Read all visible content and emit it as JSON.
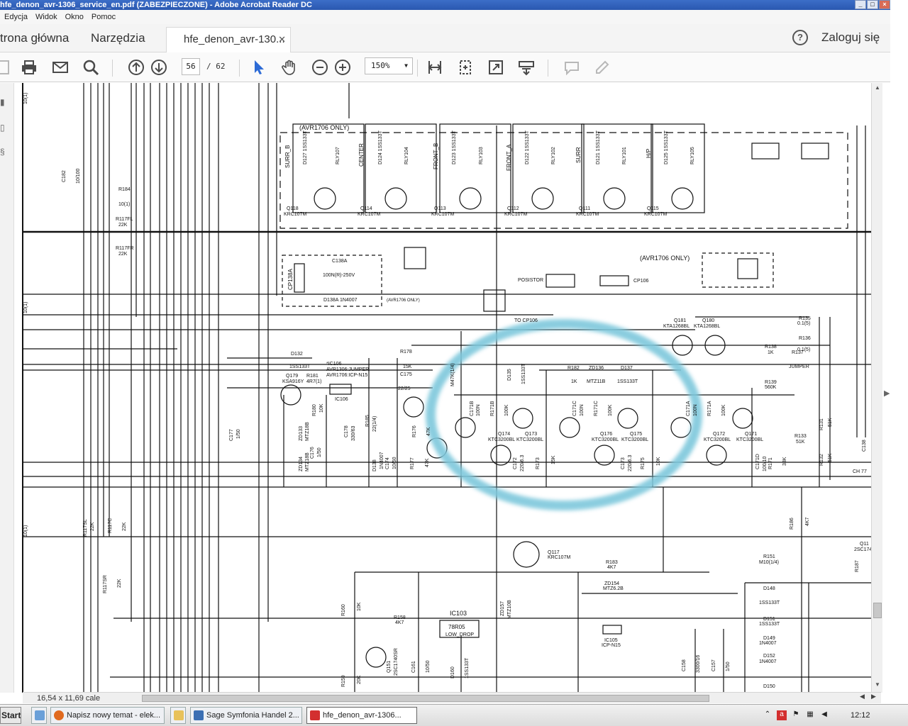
{
  "window": {
    "title": "hfe_denon_avr-1306_service_en.pdf (ZABEZPIECZONE) - Adobe Acrobat Reader DC"
  },
  "menu": [
    "Edycja",
    "Widok",
    "Okno",
    "Pomoc"
  ],
  "tabs": {
    "home": "trona główna",
    "tools": "Narzędzia",
    "doc": "hfe_denon_avr-130...",
    "help": "?",
    "login": "Zaloguj się"
  },
  "toolbar": {
    "page_current": "56",
    "page_total": "/ 62",
    "zoom": "150%"
  },
  "status": {
    "page_size": "16,54 x 11,69 cale"
  },
  "taskbar": {
    "start": "Start",
    "items": [
      {
        "label": "Napisz nowy temat - elek...",
        "icon_color": "#e06a1f"
      },
      {
        "label": "Sage Symfonia Handel 2...",
        "icon_color": "#3b6fb3"
      },
      {
        "label": "hfe_denon_avr-1306...",
        "icon_color": "#d32f2f"
      }
    ],
    "clock": "12:12"
  },
  "schematic": {
    "top_labels": {
      "avr1706_only_a": "(AVR1706 ONLY)",
      "avr1706_only_b": "(AVR1706 ONLY)",
      "avr1706_only_c": "(AVR1706 ONLY)",
      "surr_b": "SURR_B",
      "center": "CENTER",
      "front_b": "FRONT_B",
      "front_a": "FRONT_A",
      "surr": "SURR",
      "hp": "H/P"
    },
    "diodes": [
      "D127 1SS133T",
      "D124 1SS133T",
      "D123 1SS133T",
      "D122 1SS133T",
      "D121 1SS133T",
      "D125 1SS133T"
    ],
    "relays": [
      "RLY107",
      "RLY104",
      "RLY103",
      "RLY102",
      "RLY101",
      "RLY105"
    ],
    "transistors_top": [
      {
        "name": "Q118",
        "part": "KRC107M"
      },
      {
        "name": "Q114",
        "part": "KRC107M"
      },
      {
        "name": "Q113",
        "part": "KRC107M"
      },
      {
        "name": "Q112",
        "part": "KRC107M"
      },
      {
        "name": "Q111",
        "part": "KRC107M"
      },
      {
        "name": "Q115",
        "part": "KRC107M"
      }
    ],
    "misc_labels": {
      "r184": "R184",
      "r184v": "10(1)",
      "r117fl": "R117FL",
      "r117flv": "22K",
      "r117fr": "R117FR",
      "r117frv": "22K",
      "c182": "C182",
      "c182v": "10/100",
      "r10_1a": "10(1)",
      "r10_1b": "10(1)",
      "r10_1c": "10(1)",
      "cp138a": "CP138A",
      "c138a": "C138A",
      "c138av": "100N(R)-250V",
      "d138a": "D138A 1N4007",
      "avr_only": "(AVR1706 ONLY)",
      "posistor": "POSISTOR",
      "cp106": "CP106",
      "to_cp106": "TO CP106",
      "d132": "D132",
      "d132v": "1SS133T",
      "q179": "Q179",
      "q179v": "KSA916Y",
      "r181": "R181",
      "r181v": "4R7(1)",
      "ic106a": "*IC106",
      "ic106b": "AVR1306:JUMPER",
      "ic106c": "AVR1706:ICP-N15",
      "ic106": "IC106",
      "r178": "R178",
      "r178v": "15K",
      "c175": "C175",
      "c175v": "22/25",
      "m47k": "M47K(1/4)",
      "d135": "D135",
      "d135v": "1SS133T",
      "r182": "R182",
      "r182v": "1K",
      "zd136": "ZD136",
      "zd136v": "MTZ11B",
      "d137": "D137",
      "d137v": "1SS133T",
      "q181": "Q181",
      "q181v": "KTA1268BL",
      "q180": "Q180",
      "q180v": "KTA1268BL",
      "r138": "R138",
      "r138v": "1K",
      "r137": "R137",
      "r137v": "JUMPER",
      "r139": "R139",
      "r139v": "560K",
      "r135": "R135",
      "r135v": "0.1(5)",
      "r136": "R136",
      "r136v": "0.1(5)",
      "q174": "Q174",
      "q174v": "KTC3200BL",
      "q173": "Q173",
      "q173v": "KTC3200BL",
      "q176": "Q176",
      "q176v": "KTC3200BL",
      "q175": "Q175",
      "q175v": "KTC3200BL",
      "q172": "Q172",
      "q172v": "KTC3200BL",
      "q171": "Q171",
      "q171v": "KTC3200BL",
      "c171b": "C171B",
      "c171bv": "100N",
      "r171b": "R171B",
      "r171bv": "100K",
      "c171c": "C171C",
      "c171cv": "100N",
      "r171c": "R171C",
      "r171cv": "100K",
      "c171a": "C171A",
      "c171av": "100N",
      "r171a": "R171A",
      "r171av": "100K",
      "r133": "R133",
      "r133v": "51K",
      "r131": "R131",
      "r131v": "51K",
      "r132": "R132",
      "r132v": "51K",
      "c138": "C138",
      "ch": "CH 77",
      "r180": "R180",
      "r180v": "10K",
      "zd134": "ZD134",
      "zd134v": "MTZ18B",
      "zd133": "ZD133",
      "zd133v": "MTZ18B",
      "c176": "C176",
      "c176v": "1/50",
      "c178": "C178",
      "c178v": "330/63",
      "r185": "R185",
      "r185v": "22(1/4)",
      "d138": "D138",
      "d138v": "1N4007",
      "c177": "C177",
      "c177v": "1/50",
      "c174": "C174",
      "c174v": "10/50",
      "r177": "R177",
      "r177v": "47K",
      "r176": "R176",
      "r176v": "47K",
      "c172": "C172",
      "c172v": "220/6.3",
      "r173": "R173",
      "r173v": "15K",
      "c173": "C173",
      "c173v": "220/6.3",
      "r175": "R175",
      "r175v": "10K",
      "r171": "R171",
      "r171v": "33K",
      "c171d": "C171D",
      "c171dv": "100/10",
      "r117sl": "R117SL",
      "r117slv": "22K",
      "r117c": "R117C",
      "r117cv": "22K",
      "r117sr": "R117SR",
      "r117srv": "22K",
      "r186": "R186",
      "r186v": "4K7",
      "q117": "Q117",
      "q117v": "KRC107M",
      "r183": "R183",
      "r183v": "4K7",
      "zd154": "ZD154",
      "zd154v": "MTZ6.2B",
      "r151": "R151",
      "r151v": "M10(1/4)",
      "q11x": "Q11",
      "q11xv": "2SC1740S",
      "r187": "R187",
      "d148": "D148",
      "d148v": "1SS133T",
      "d151": "D151",
      "d151v": "1SS133T",
      "d149": "D149",
      "d149v": "1N4007",
      "d152": "D152",
      "d152v": "1N4007",
      "d150": "D150",
      "r160": "R160",
      "r160v": "10K",
      "r158": "R158",
      "r158v": "4K7",
      "ic103": "IC103",
      "ic103a": "78R05",
      "ic103b": "LOW_DROP",
      "q151": "Q151",
      "q151v": "2SC1740SR",
      "c161": "C161",
      "c161v": "10/50",
      "d160": "D160",
      "d160v": "1SS133T",
      "zd157": "ZD157",
      "zd157v": "MTZ10B",
      "ic105": "IC105",
      "ic105v": "ICP-N15",
      "c158": "C158",
      "c158v": "3300/16",
      "c157": "C157",
      "c157v": "1/50",
      "r159": "R159",
      "r159v": "20K"
    }
  },
  "colors": {
    "accent": "#2d6bd6",
    "highlight": "#7ec8dc",
    "titlebar": "#2a58b0"
  }
}
